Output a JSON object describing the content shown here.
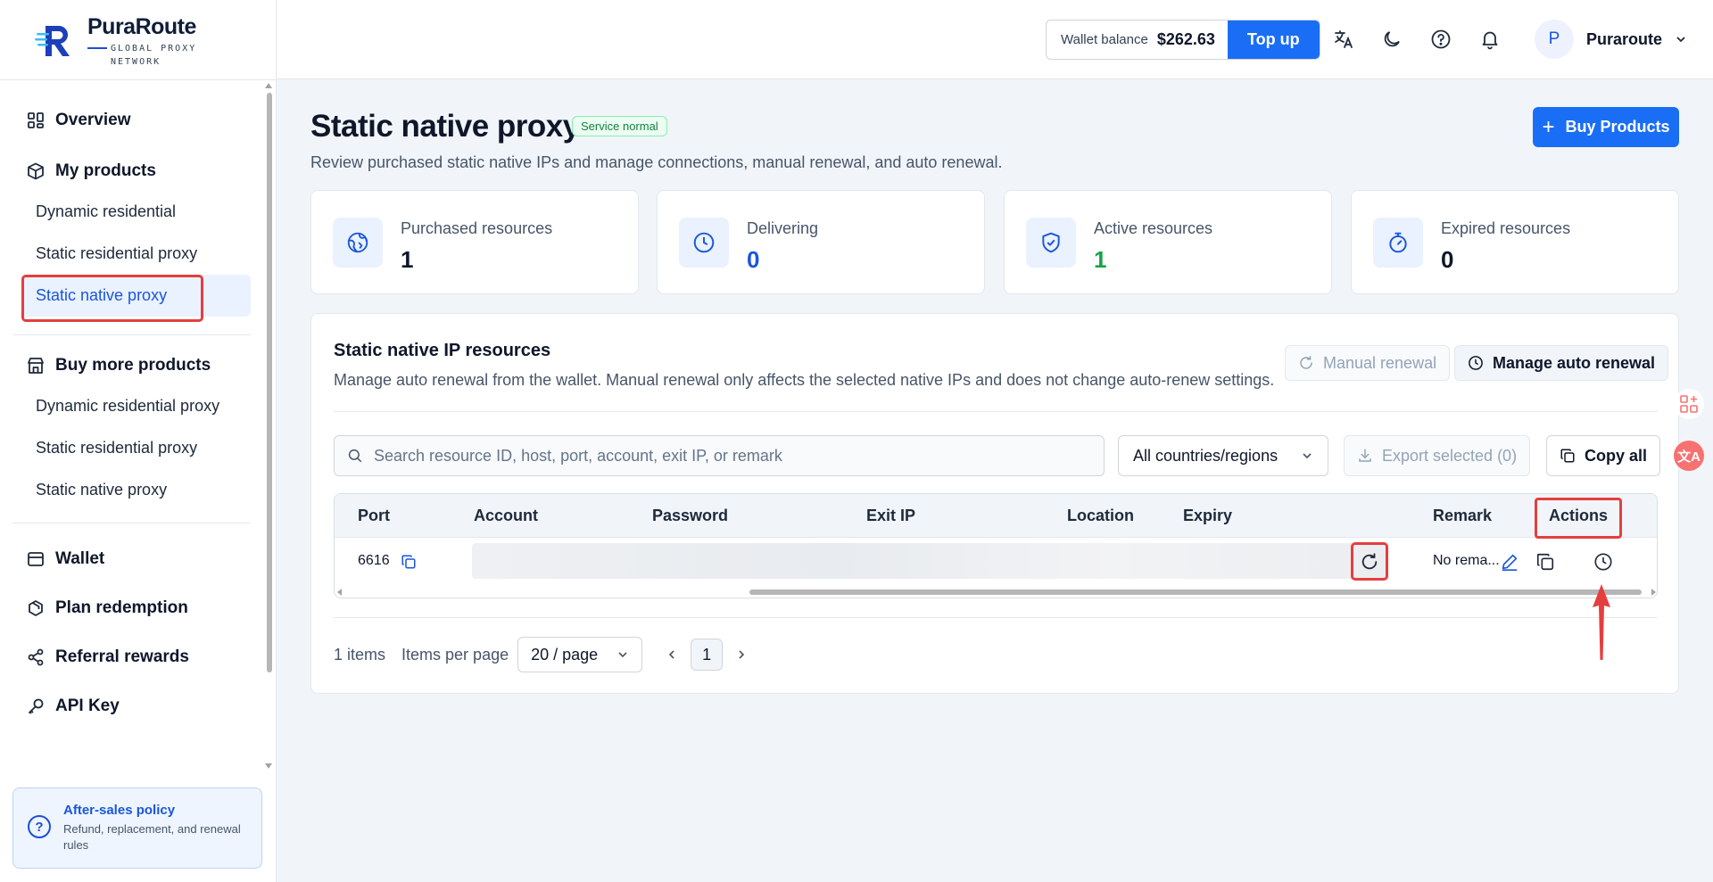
{
  "brand": {
    "name": "PuraRoute",
    "tagline_line1": "GLOBAL PROXY",
    "tagline_line2": "NETWORK"
  },
  "sidebar": {
    "overview": "Overview",
    "my_products": "My products",
    "my_products_items": [
      "Dynamic residential",
      "Static residential proxy",
      "Static native proxy"
    ],
    "buy_more": "Buy more products",
    "buy_more_items": [
      "Dynamic residential proxy",
      "Static residential proxy",
      "Static native proxy"
    ],
    "wallet": "Wallet",
    "plan_redemption": "Plan redemption",
    "referral_rewards": "Referral rewards",
    "api_key": "API Key",
    "policy_title": "After-sales policy",
    "policy_desc": "Refund, replacement, and renewal rules"
  },
  "header": {
    "wallet_label": "Wallet balance",
    "wallet_amount": "$262.63",
    "topup_label": "Top up",
    "avatar_letter": "P",
    "user_name": "Puraroute"
  },
  "page": {
    "title": "Static native proxy",
    "status_badge": "Service normal",
    "subtitle": "Review purchased static native IPs and manage connections, manual renewal, and auto renewal.",
    "buy_button": "Buy Products"
  },
  "stats": [
    {
      "label": "Purchased resources",
      "value": "1",
      "color": "#0f172a"
    },
    {
      "label": "Delivering",
      "value": "0",
      "color": "#1a56db"
    },
    {
      "label": "Active resources",
      "value": "1",
      "color": "#16a34a"
    },
    {
      "label": "Expired resources",
      "value": "0",
      "color": "#0f172a"
    }
  ],
  "resources": {
    "title": "Static native IP resources",
    "desc": "Manage auto renewal from the wallet. Manual renewal only affects the selected native IPs and does not change auto-renew settings.",
    "manual_renewal": "Manual renewal",
    "manage_auto_renewal": "Manage auto renewal",
    "search_placeholder": "Search resource ID, host, port, account, exit IP, or remark",
    "region_select": "All countries/regions",
    "export_selected": "Export selected (0)",
    "copy_all": "Copy all",
    "columns": [
      "Port",
      "Account",
      "Password",
      "Exit IP",
      "Location",
      "Expiry",
      "Remark",
      "Actions"
    ],
    "rows": [
      {
        "port": "6616",
        "remark": "No rema..."
      }
    ],
    "items_count": "1 items",
    "items_per_page_label": "Items per page",
    "page_size": "20 / page",
    "current_page": "1"
  },
  "colors": {
    "accent": "#1a6ef5",
    "highlight": "#e53e3e",
    "success": "#16a34a"
  }
}
